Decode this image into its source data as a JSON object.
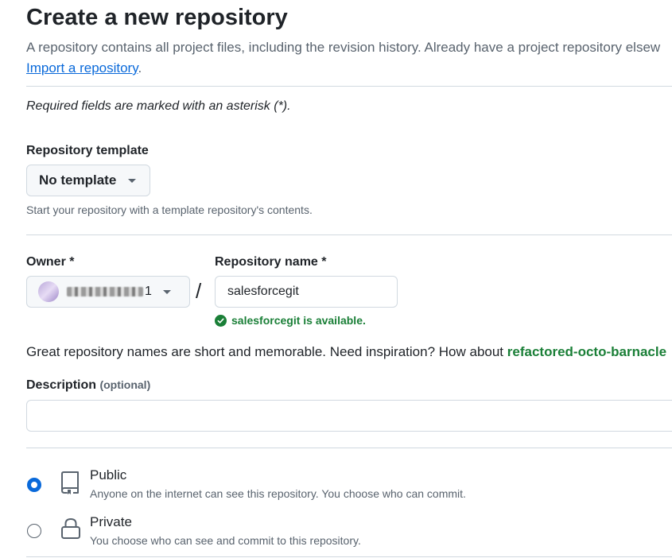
{
  "page": {
    "title": "Create a new repository",
    "subtitle": "A repository contains all project files, including the revision history. Already have a project repository elsew",
    "import_link": "Import a repository",
    "import_suffix": ".",
    "required_note": "Required fields are marked with an asterisk (*)."
  },
  "template": {
    "label": "Repository template",
    "value": "No template",
    "help": "Start your repository with a template repository's contents."
  },
  "owner": {
    "label": "Owner *",
    "value_visible": "1"
  },
  "repo_name": {
    "label": "Repository name *",
    "value": "salesforcegit",
    "availability": "salesforcegit is available."
  },
  "inspiration": {
    "text": "Great repository names are short and memorable. Need inspiration? How about ",
    "suggestion": "refactored-octo-barnacle"
  },
  "description": {
    "label": "Description",
    "optional": "(optional)",
    "value": ""
  },
  "visibility": {
    "options": [
      {
        "title": "Public",
        "desc": "Anyone on the internet can see this repository. You choose who can commit.",
        "selected": true,
        "icon": "repo-icon"
      },
      {
        "title": "Private",
        "desc": "You choose who can see and commit to this repository.",
        "selected": false,
        "icon": "lock-icon"
      }
    ]
  },
  "colors": {
    "accent": "#0969da",
    "success": "#1a7f37",
    "border": "#d1d9e0",
    "muted": "#59636e"
  }
}
